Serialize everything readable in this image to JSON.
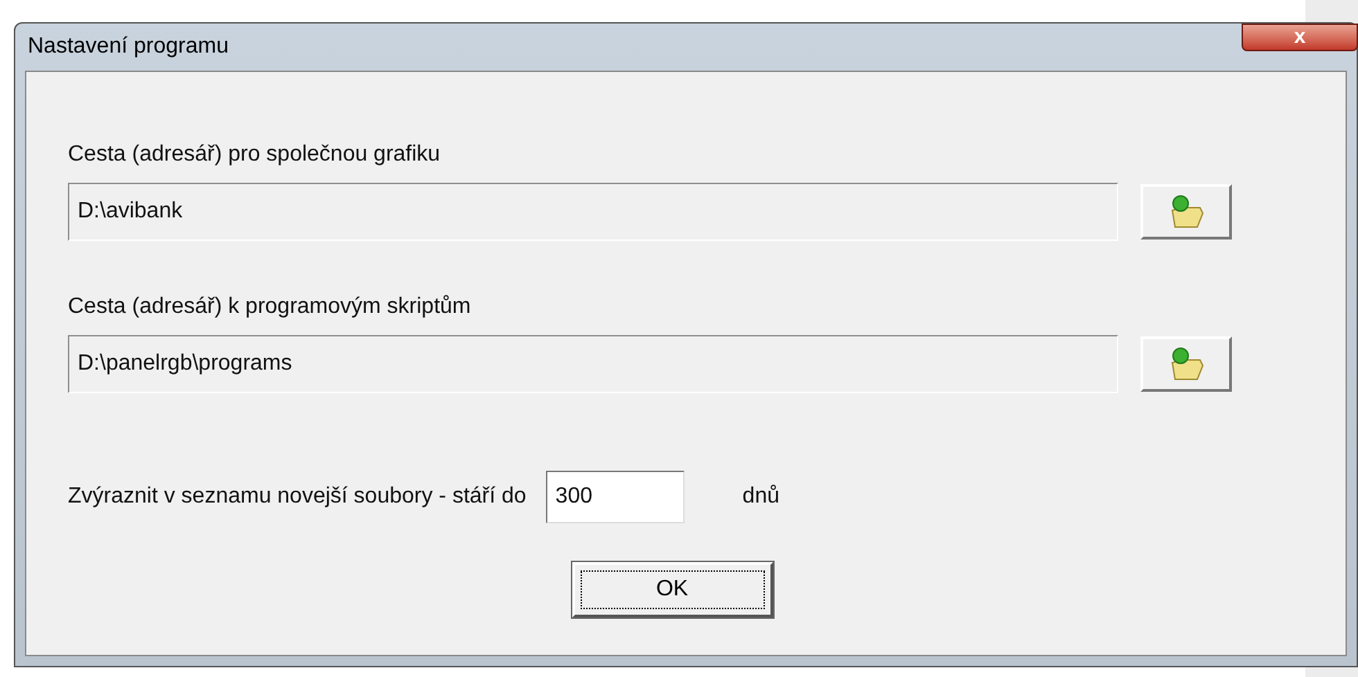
{
  "window": {
    "title": "Nastavení programu",
    "close_label": "x"
  },
  "paths": [
    {
      "label": "Cesta (adresář) pro společnou grafiku",
      "value": "D:\\avibank"
    },
    {
      "label": "Cesta (adresář) k programovým skriptům",
      "value": "D:\\panelrgb\\programs"
    }
  ],
  "age": {
    "label": "Zvýraznit v seznamu novejší soubory - stáří do",
    "value": "300",
    "unit": "dnů"
  },
  "buttons": [
    {
      "label": "OK",
      "focused": true
    }
  ]
}
